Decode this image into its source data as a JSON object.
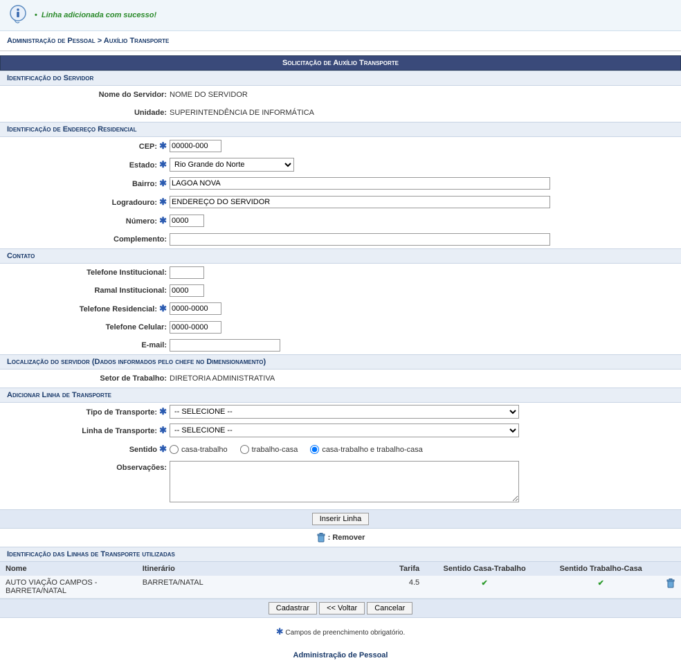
{
  "message": {
    "text": "Linha adicionada com sucesso!"
  },
  "breadcrumb": {
    "part1": "Administração de Pessoal",
    "sep": ">",
    "part2": "Auxílio Transporte"
  },
  "main_title": "Solicitação de Auxílio Transporte",
  "sections": {
    "ident_servidor": "Identificação do Servidor",
    "ident_endereco": "Identificação de Endereço Residencial",
    "contato": "Contato",
    "localizacao": "Localização do servidor (Dados informados pelo chefe no Dimensionamento)",
    "add_linha": "Adicionar Linha de Transporte",
    "ident_linhas": "Identificação das Linhas de Transporte utilizadas"
  },
  "labels": {
    "nome_servidor": "Nome do Servidor:",
    "unidade": "Unidade:",
    "cep": "CEP:",
    "estado": "Estado:",
    "bairro": "Bairro:",
    "logradouro": "Logradouro:",
    "numero": "Número:",
    "complemento": "Complemento:",
    "tel_inst": "Telefone Institucional:",
    "ramal_inst": "Ramal Institucional:",
    "tel_res": "Telefone Residencial:",
    "tel_cel": "Telefone Celular:",
    "email": "E-mail:",
    "setor_trabalho": "Setor de Trabalho:",
    "tipo_transporte": "Tipo de Transporte:",
    "linha_transporte": "Linha de Transporte:",
    "sentido": "Sentido",
    "observacoes": "Observações:"
  },
  "values": {
    "nome_servidor": "NOME DO SERVIDOR",
    "unidade": "SUPERINTENDÊNCIA DE INFORMÁTICA",
    "cep": "00000-000",
    "estado": "Rio Grande do Norte",
    "bairro": "LAGOA NOVA",
    "logradouro": "ENDEREÇO DO SERVIDOR",
    "numero": "0000",
    "complemento": "",
    "tel_inst": "",
    "ramal_inst": "0000",
    "tel_res": "0000-0000",
    "tel_cel": "0000-0000",
    "email": "",
    "setor_trabalho": "DIRETORIA ADMINISTRATIVA",
    "tipo_transporte": "-- SELECIONE --",
    "linha_transporte": "-- SELECIONE --",
    "observacoes": ""
  },
  "radios": {
    "opt1": "casa-trabalho",
    "opt2": "trabalho-casa",
    "opt3": "casa-trabalho e trabalho-casa",
    "selected": "opt3"
  },
  "buttons": {
    "inserir": "Inserir Linha",
    "cadastrar": "Cadastrar",
    "voltar": "<< Voltar",
    "cancelar": "Cancelar"
  },
  "legend": {
    "remover": ": Remover"
  },
  "table": {
    "headers": {
      "nome": "Nome",
      "itinerario": "Itinerário",
      "tarifa": "Tarifa",
      "sct": "Sentido Casa-Trabalho",
      "stc": "Sentido Trabalho-Casa"
    },
    "rows": [
      {
        "nome": "AUTO VIAÇÃO CAMPOS - BARRETA/NATAL",
        "itinerario": "BARRETA/NATAL",
        "tarifa": "4.5",
        "sct": true,
        "stc": true
      }
    ]
  },
  "footer": {
    "note": "Campos de preenchimento obrigatório.",
    "link": "Administração de Pessoal"
  },
  "glyphs": {
    "req": "✱",
    "check": "✔"
  }
}
